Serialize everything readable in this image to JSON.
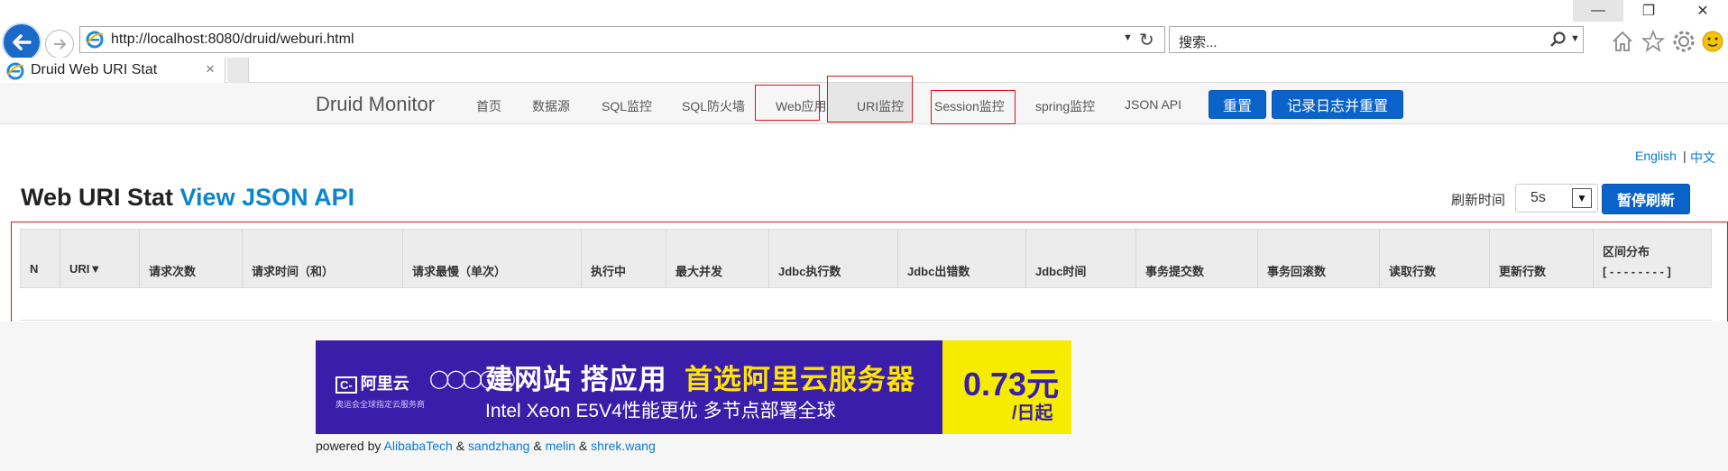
{
  "browser": {
    "window_buttons": {
      "minimize": "—",
      "restore": "❐",
      "close": "✕"
    },
    "url_prefix": "http://",
    "url_host": "localhost",
    "url_rest": ":8080/druid/weburi.html",
    "search_placeholder": "搜索...",
    "tab_title": "Druid Web URI Stat",
    "tab_close": "×"
  },
  "nav": {
    "brand": "Druid Monitor",
    "items": [
      "首页",
      "数据源",
      "SQL监控",
      "SQL防火墙",
      "Web应用",
      "URI监控",
      "Session监控",
      "spring监控",
      "JSON API"
    ],
    "reset_label": "重置",
    "log_reset_label": "记录日志并重置"
  },
  "lang": {
    "english": "English",
    "separator": "|",
    "chinese": "中文"
  },
  "heading": {
    "title": "Web URI Stat",
    "link": "View JSON API"
  },
  "refresh": {
    "label": "刷新时间",
    "value": "5s",
    "pause_label": "暂停刷新"
  },
  "table": {
    "columns": [
      "N",
      "URI▼",
      "请求次数",
      "请求时间（和）",
      "请求最慢（单次）",
      "执行中",
      "最大并发",
      "Jdbc执行数",
      "Jdbc出错数",
      "Jdbc时间",
      "事务提交数",
      "事务回滚数",
      "读取行数",
      "更新行数"
    ],
    "dist_title": "区间分布",
    "dist_value": "[ - - - - - - - - ]"
  },
  "ad": {
    "logo": "阿里云",
    "logo_sub": "奥运会全球指定云服务商",
    "headline_1": "建网站 搭应用",
    "headline_2": "首选阿里云服务器",
    "subline": "Intel Xeon E5V4性能更优 多节点部署全球",
    "price": "0.73元",
    "unit": "/日起"
  },
  "footer": {
    "prefix": "powered by",
    "authors": [
      "AlibabaTech",
      "sandzhang",
      "melin",
      "shrek.wang"
    ],
    "joiner": "&"
  },
  "colors": {
    "accent": "#0a63c9",
    "link": "#0a7bd1",
    "highlight": "#e0111b"
  }
}
